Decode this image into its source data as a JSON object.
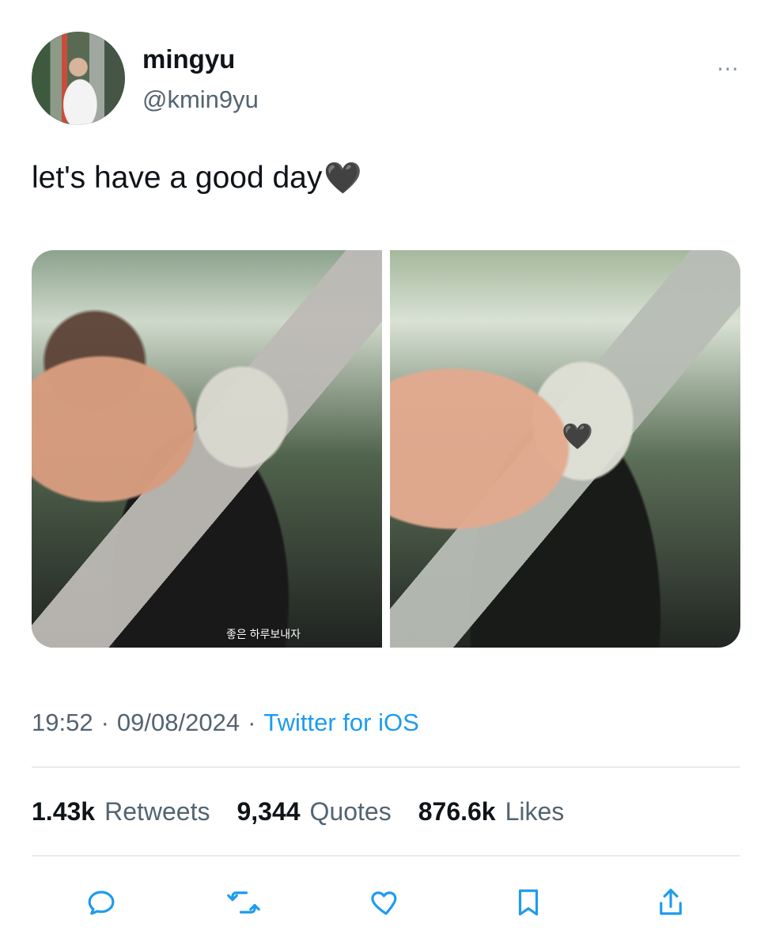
{
  "profile": {
    "name": "mingyu",
    "handle": "@kmin9yu"
  },
  "tweet": {
    "text": "let's have a good day",
    "emoji": "🖤",
    "photo_caption": "좋은 하루보내자"
  },
  "meta": {
    "time": "19:52",
    "separator1": "·",
    "date": "09/08/2024",
    "separator2": "·",
    "source": "Twitter for iOS"
  },
  "stats": [
    {
      "value": "1.43k",
      "label": "Retweets"
    },
    {
      "value": "9,344",
      "label": "Quotes"
    },
    {
      "value": "876.6k",
      "label": "Likes"
    }
  ],
  "ui": {
    "more_icon": "⋯",
    "accent": "#1d9bf0",
    "icons": [
      "reply-icon",
      "retweet-icon",
      "like-icon",
      "bookmark-icon",
      "share-icon"
    ]
  }
}
